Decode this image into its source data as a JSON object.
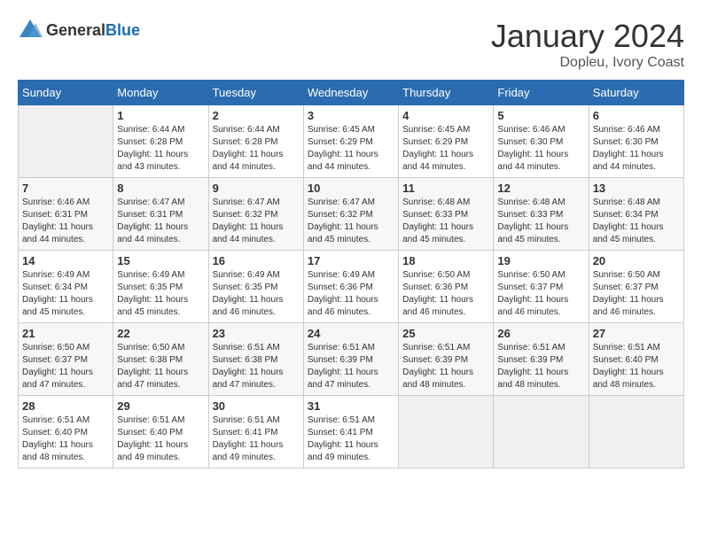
{
  "header": {
    "logo_general": "General",
    "logo_blue": "Blue",
    "month_title": "January 2024",
    "subtitle": "Dopleu, Ivory Coast"
  },
  "weekdays": [
    "Sunday",
    "Monday",
    "Tuesday",
    "Wednesday",
    "Thursday",
    "Friday",
    "Saturday"
  ],
  "weeks": [
    [
      {
        "day": "",
        "sunrise": "",
        "sunset": "",
        "daylight": ""
      },
      {
        "day": "1",
        "sunrise": "Sunrise: 6:44 AM",
        "sunset": "Sunset: 6:28 PM",
        "daylight": "Daylight: 11 hours and 43 minutes."
      },
      {
        "day": "2",
        "sunrise": "Sunrise: 6:44 AM",
        "sunset": "Sunset: 6:28 PM",
        "daylight": "Daylight: 11 hours and 44 minutes."
      },
      {
        "day": "3",
        "sunrise": "Sunrise: 6:45 AM",
        "sunset": "Sunset: 6:29 PM",
        "daylight": "Daylight: 11 hours and 44 minutes."
      },
      {
        "day": "4",
        "sunrise": "Sunrise: 6:45 AM",
        "sunset": "Sunset: 6:29 PM",
        "daylight": "Daylight: 11 hours and 44 minutes."
      },
      {
        "day": "5",
        "sunrise": "Sunrise: 6:46 AM",
        "sunset": "Sunset: 6:30 PM",
        "daylight": "Daylight: 11 hours and 44 minutes."
      },
      {
        "day": "6",
        "sunrise": "Sunrise: 6:46 AM",
        "sunset": "Sunset: 6:30 PM",
        "daylight": "Daylight: 11 hours and 44 minutes."
      }
    ],
    [
      {
        "day": "7",
        "sunrise": "Sunrise: 6:46 AM",
        "sunset": "Sunset: 6:31 PM",
        "daylight": "Daylight: 11 hours and 44 minutes."
      },
      {
        "day": "8",
        "sunrise": "Sunrise: 6:47 AM",
        "sunset": "Sunset: 6:31 PM",
        "daylight": "Daylight: 11 hours and 44 minutes."
      },
      {
        "day": "9",
        "sunrise": "Sunrise: 6:47 AM",
        "sunset": "Sunset: 6:32 PM",
        "daylight": "Daylight: 11 hours and 44 minutes."
      },
      {
        "day": "10",
        "sunrise": "Sunrise: 6:47 AM",
        "sunset": "Sunset: 6:32 PM",
        "daylight": "Daylight: 11 hours and 45 minutes."
      },
      {
        "day": "11",
        "sunrise": "Sunrise: 6:48 AM",
        "sunset": "Sunset: 6:33 PM",
        "daylight": "Daylight: 11 hours and 45 minutes."
      },
      {
        "day": "12",
        "sunrise": "Sunrise: 6:48 AM",
        "sunset": "Sunset: 6:33 PM",
        "daylight": "Daylight: 11 hours and 45 minutes."
      },
      {
        "day": "13",
        "sunrise": "Sunrise: 6:48 AM",
        "sunset": "Sunset: 6:34 PM",
        "daylight": "Daylight: 11 hours and 45 minutes."
      }
    ],
    [
      {
        "day": "14",
        "sunrise": "Sunrise: 6:49 AM",
        "sunset": "Sunset: 6:34 PM",
        "daylight": "Daylight: 11 hours and 45 minutes."
      },
      {
        "day": "15",
        "sunrise": "Sunrise: 6:49 AM",
        "sunset": "Sunset: 6:35 PM",
        "daylight": "Daylight: 11 hours and 45 minutes."
      },
      {
        "day": "16",
        "sunrise": "Sunrise: 6:49 AM",
        "sunset": "Sunset: 6:35 PM",
        "daylight": "Daylight: 11 hours and 46 minutes."
      },
      {
        "day": "17",
        "sunrise": "Sunrise: 6:49 AM",
        "sunset": "Sunset: 6:36 PM",
        "daylight": "Daylight: 11 hours and 46 minutes."
      },
      {
        "day": "18",
        "sunrise": "Sunrise: 6:50 AM",
        "sunset": "Sunset: 6:36 PM",
        "daylight": "Daylight: 11 hours and 46 minutes."
      },
      {
        "day": "19",
        "sunrise": "Sunrise: 6:50 AM",
        "sunset": "Sunset: 6:37 PM",
        "daylight": "Daylight: 11 hours and 46 minutes."
      },
      {
        "day": "20",
        "sunrise": "Sunrise: 6:50 AM",
        "sunset": "Sunset: 6:37 PM",
        "daylight": "Daylight: 11 hours and 46 minutes."
      }
    ],
    [
      {
        "day": "21",
        "sunrise": "Sunrise: 6:50 AM",
        "sunset": "Sunset: 6:37 PM",
        "daylight": "Daylight: 11 hours and 47 minutes."
      },
      {
        "day": "22",
        "sunrise": "Sunrise: 6:50 AM",
        "sunset": "Sunset: 6:38 PM",
        "daylight": "Daylight: 11 hours and 47 minutes."
      },
      {
        "day": "23",
        "sunrise": "Sunrise: 6:51 AM",
        "sunset": "Sunset: 6:38 PM",
        "daylight": "Daylight: 11 hours and 47 minutes."
      },
      {
        "day": "24",
        "sunrise": "Sunrise: 6:51 AM",
        "sunset": "Sunset: 6:39 PM",
        "daylight": "Daylight: 11 hours and 47 minutes."
      },
      {
        "day": "25",
        "sunrise": "Sunrise: 6:51 AM",
        "sunset": "Sunset: 6:39 PM",
        "daylight": "Daylight: 11 hours and 48 minutes."
      },
      {
        "day": "26",
        "sunrise": "Sunrise: 6:51 AM",
        "sunset": "Sunset: 6:39 PM",
        "daylight": "Daylight: 11 hours and 48 minutes."
      },
      {
        "day": "27",
        "sunrise": "Sunrise: 6:51 AM",
        "sunset": "Sunset: 6:40 PM",
        "daylight": "Daylight: 11 hours and 48 minutes."
      }
    ],
    [
      {
        "day": "28",
        "sunrise": "Sunrise: 6:51 AM",
        "sunset": "Sunset: 6:40 PM",
        "daylight": "Daylight: 11 hours and 48 minutes."
      },
      {
        "day": "29",
        "sunrise": "Sunrise: 6:51 AM",
        "sunset": "Sunset: 6:40 PM",
        "daylight": "Daylight: 11 hours and 49 minutes."
      },
      {
        "day": "30",
        "sunrise": "Sunrise: 6:51 AM",
        "sunset": "Sunset: 6:41 PM",
        "daylight": "Daylight: 11 hours and 49 minutes."
      },
      {
        "day": "31",
        "sunrise": "Sunrise: 6:51 AM",
        "sunset": "Sunset: 6:41 PM",
        "daylight": "Daylight: 11 hours and 49 minutes."
      },
      {
        "day": "",
        "sunrise": "",
        "sunset": "",
        "daylight": ""
      },
      {
        "day": "",
        "sunrise": "",
        "sunset": "",
        "daylight": ""
      },
      {
        "day": "",
        "sunrise": "",
        "sunset": "",
        "daylight": ""
      }
    ]
  ]
}
